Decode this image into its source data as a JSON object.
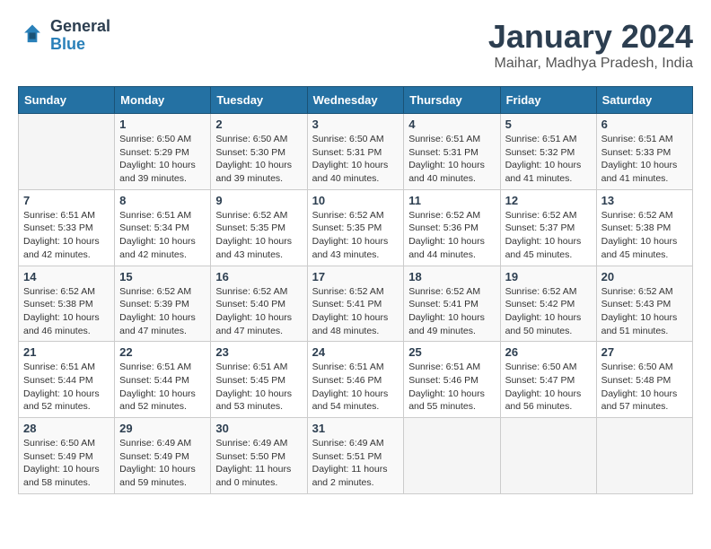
{
  "header": {
    "logo_line1": "General",
    "logo_line2": "Blue",
    "title": "January 2024",
    "subtitle": "Maihar, Madhya Pradesh, India"
  },
  "columns": [
    "Sunday",
    "Monday",
    "Tuesday",
    "Wednesday",
    "Thursday",
    "Friday",
    "Saturday"
  ],
  "rows": [
    [
      {
        "num": "",
        "detail": ""
      },
      {
        "num": "1",
        "detail": "Sunrise: 6:50 AM\nSunset: 5:29 PM\nDaylight: 10 hours\nand 39 minutes."
      },
      {
        "num": "2",
        "detail": "Sunrise: 6:50 AM\nSunset: 5:30 PM\nDaylight: 10 hours\nand 39 minutes."
      },
      {
        "num": "3",
        "detail": "Sunrise: 6:50 AM\nSunset: 5:31 PM\nDaylight: 10 hours\nand 40 minutes."
      },
      {
        "num": "4",
        "detail": "Sunrise: 6:51 AM\nSunset: 5:31 PM\nDaylight: 10 hours\nand 40 minutes."
      },
      {
        "num": "5",
        "detail": "Sunrise: 6:51 AM\nSunset: 5:32 PM\nDaylight: 10 hours\nand 41 minutes."
      },
      {
        "num": "6",
        "detail": "Sunrise: 6:51 AM\nSunset: 5:33 PM\nDaylight: 10 hours\nand 41 minutes."
      }
    ],
    [
      {
        "num": "7",
        "detail": "Sunrise: 6:51 AM\nSunset: 5:33 PM\nDaylight: 10 hours\nand 42 minutes."
      },
      {
        "num": "8",
        "detail": "Sunrise: 6:51 AM\nSunset: 5:34 PM\nDaylight: 10 hours\nand 42 minutes."
      },
      {
        "num": "9",
        "detail": "Sunrise: 6:52 AM\nSunset: 5:35 PM\nDaylight: 10 hours\nand 43 minutes."
      },
      {
        "num": "10",
        "detail": "Sunrise: 6:52 AM\nSunset: 5:35 PM\nDaylight: 10 hours\nand 43 minutes."
      },
      {
        "num": "11",
        "detail": "Sunrise: 6:52 AM\nSunset: 5:36 PM\nDaylight: 10 hours\nand 44 minutes."
      },
      {
        "num": "12",
        "detail": "Sunrise: 6:52 AM\nSunset: 5:37 PM\nDaylight: 10 hours\nand 45 minutes."
      },
      {
        "num": "13",
        "detail": "Sunrise: 6:52 AM\nSunset: 5:38 PM\nDaylight: 10 hours\nand 45 minutes."
      }
    ],
    [
      {
        "num": "14",
        "detail": "Sunrise: 6:52 AM\nSunset: 5:38 PM\nDaylight: 10 hours\nand 46 minutes."
      },
      {
        "num": "15",
        "detail": "Sunrise: 6:52 AM\nSunset: 5:39 PM\nDaylight: 10 hours\nand 47 minutes."
      },
      {
        "num": "16",
        "detail": "Sunrise: 6:52 AM\nSunset: 5:40 PM\nDaylight: 10 hours\nand 47 minutes."
      },
      {
        "num": "17",
        "detail": "Sunrise: 6:52 AM\nSunset: 5:41 PM\nDaylight: 10 hours\nand 48 minutes."
      },
      {
        "num": "18",
        "detail": "Sunrise: 6:52 AM\nSunset: 5:41 PM\nDaylight: 10 hours\nand 49 minutes."
      },
      {
        "num": "19",
        "detail": "Sunrise: 6:52 AM\nSunset: 5:42 PM\nDaylight: 10 hours\nand 50 minutes."
      },
      {
        "num": "20",
        "detail": "Sunrise: 6:52 AM\nSunset: 5:43 PM\nDaylight: 10 hours\nand 51 minutes."
      }
    ],
    [
      {
        "num": "21",
        "detail": "Sunrise: 6:51 AM\nSunset: 5:44 PM\nDaylight: 10 hours\nand 52 minutes."
      },
      {
        "num": "22",
        "detail": "Sunrise: 6:51 AM\nSunset: 5:44 PM\nDaylight: 10 hours\nand 52 minutes."
      },
      {
        "num": "23",
        "detail": "Sunrise: 6:51 AM\nSunset: 5:45 PM\nDaylight: 10 hours\nand 53 minutes."
      },
      {
        "num": "24",
        "detail": "Sunrise: 6:51 AM\nSunset: 5:46 PM\nDaylight: 10 hours\nand 54 minutes."
      },
      {
        "num": "25",
        "detail": "Sunrise: 6:51 AM\nSunset: 5:46 PM\nDaylight: 10 hours\nand 55 minutes."
      },
      {
        "num": "26",
        "detail": "Sunrise: 6:50 AM\nSunset: 5:47 PM\nDaylight: 10 hours\nand 56 minutes."
      },
      {
        "num": "27",
        "detail": "Sunrise: 6:50 AM\nSunset: 5:48 PM\nDaylight: 10 hours\nand 57 minutes."
      }
    ],
    [
      {
        "num": "28",
        "detail": "Sunrise: 6:50 AM\nSunset: 5:49 PM\nDaylight: 10 hours\nand 58 minutes."
      },
      {
        "num": "29",
        "detail": "Sunrise: 6:49 AM\nSunset: 5:49 PM\nDaylight: 10 hours\nand 59 minutes."
      },
      {
        "num": "30",
        "detail": "Sunrise: 6:49 AM\nSunset: 5:50 PM\nDaylight: 11 hours\nand 0 minutes."
      },
      {
        "num": "31",
        "detail": "Sunrise: 6:49 AM\nSunset: 5:51 PM\nDaylight: 11 hours\nand 2 minutes."
      },
      {
        "num": "",
        "detail": ""
      },
      {
        "num": "",
        "detail": ""
      },
      {
        "num": "",
        "detail": ""
      }
    ]
  ]
}
